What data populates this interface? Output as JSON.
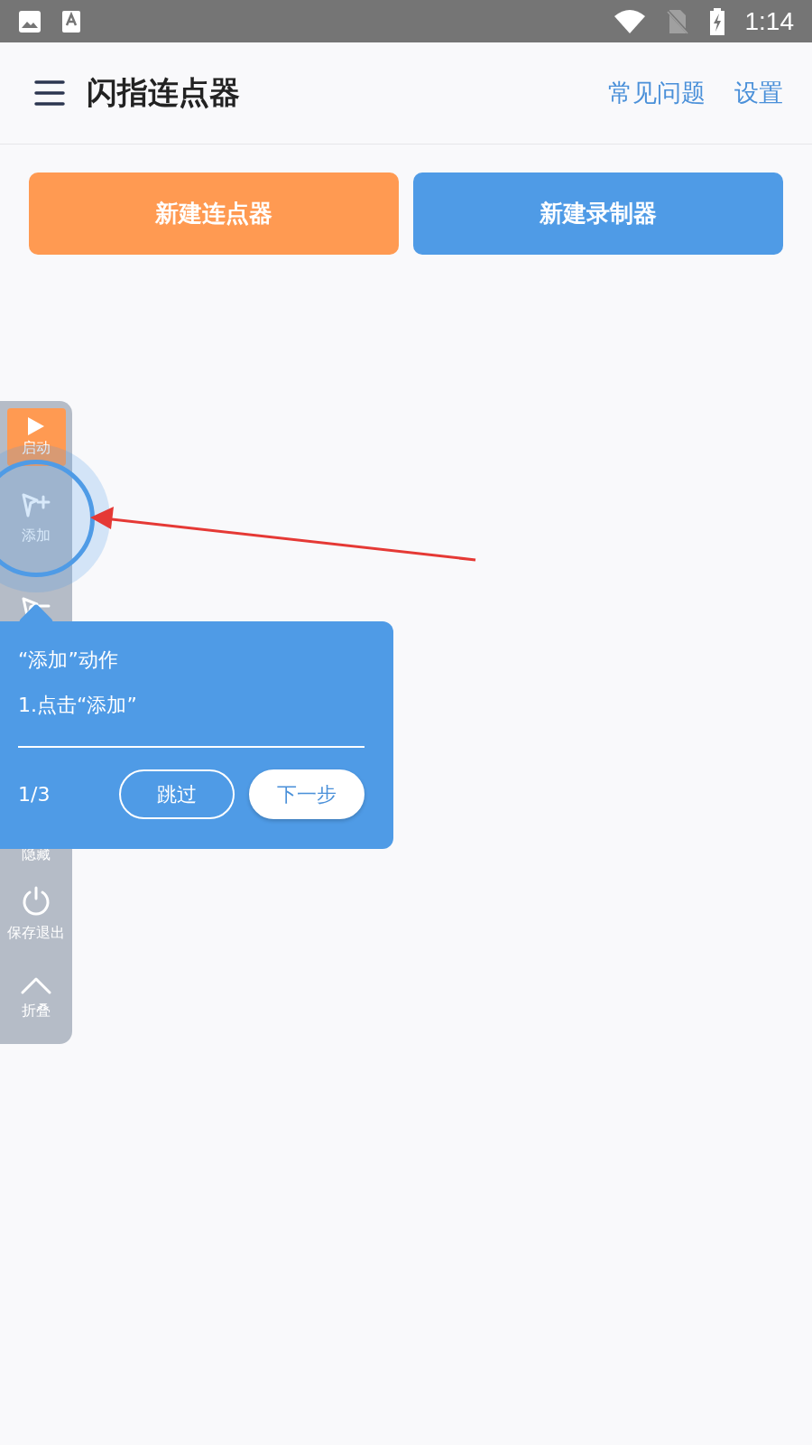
{
  "status_bar": {
    "time": "1:14"
  },
  "app_bar": {
    "title": "闪指连点器",
    "links": [
      "常见问题",
      "设置"
    ]
  },
  "actions": [
    {
      "label": "新建连点器",
      "color": "#ff9a52"
    },
    {
      "label": "新建录制器",
      "color": "#4f9be6"
    }
  ],
  "floating_toolbar": {
    "items": [
      {
        "kind": "start",
        "label": "启动"
      },
      {
        "kind": "add",
        "label": "添加"
      },
      {
        "kind": "remove"
      },
      {
        "kind": "hide",
        "label": "隐藏"
      },
      {
        "kind": "power",
        "label": "保存退出"
      },
      {
        "kind": "collapse",
        "label": "折叠"
      }
    ]
  },
  "guide": {
    "title": "“添加”动作",
    "step": "1.点击“添加”",
    "progress": "1/3",
    "buttons": [
      {
        "kind": "outline",
        "label": "跳过"
      },
      {
        "kind": "filled",
        "label": "下一步"
      }
    ]
  }
}
